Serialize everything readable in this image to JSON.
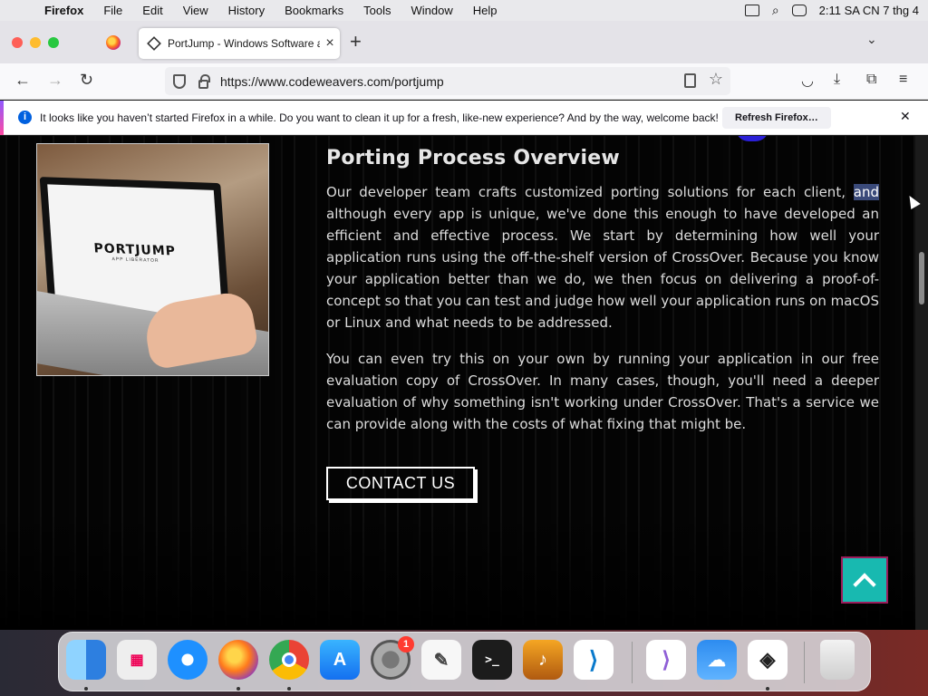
{
  "menubar": {
    "app": "Firefox",
    "items": [
      "File",
      "Edit",
      "View",
      "History",
      "Bookmarks",
      "Tools",
      "Window",
      "Help"
    ],
    "clock": "2:11 SA CN 7 thg 4"
  },
  "tabs": {
    "active_title": "PortJump - Windows Software a"
  },
  "navbar": {
    "url": "https://www.codeweavers.com/portjump"
  },
  "notification": {
    "message": "It looks like you haven’t started Firefox in a while. Do you want to clean it up for a fresh, like-new experience? And by the way, welcome back!",
    "button": "Refresh Firefox…"
  },
  "content": {
    "hero_logo": "PORTJUMP",
    "hero_tagline": "APP LIBERATOR",
    "title": "Porting Process Overview",
    "para1_before": "Our developer team crafts customized porting solutions for each client, ",
    "para1_selected": "and",
    "para1_after": " although every app is unique, we've done this enough to have developed an efficient and effective process. We start by determining how well your application runs using the off-the-shelf version of CrossOver. Because you know your application better than we do, we then focus on delivering a proof-of-concept so that you can test and judge how well your application runs on macOS or Linux and what needs to be addressed.",
    "para2": "You can even try this on your own by running your application in our free evaluation copy of CrossOver. In many cases, though, you'll need a deeper evaluation of why something isn't working under CrossOver. That's a service we can provide along with the costs of what fixing that might be.",
    "contact_button": "CONTACT US"
  },
  "dock": {
    "apps": [
      {
        "name": "finder-icon",
        "color": "#2d8cf0"
      },
      {
        "name": "launchpad-icon",
        "color": "#e8e8ea"
      },
      {
        "name": "safari-icon",
        "color": "#1e90ff"
      },
      {
        "name": "firefox-icon",
        "color": "#ff6f1f"
      },
      {
        "name": "chrome-icon",
        "color": "#ffffff"
      },
      {
        "name": "app-store-icon",
        "color": "#1a8cff"
      },
      {
        "name": "system-settings-icon",
        "color": "#8e8e93"
      },
      {
        "name": "textedit-icon",
        "color": "#f4f4f4"
      },
      {
        "name": "terminal-icon",
        "color": "#1c1c1c"
      },
      {
        "name": "garageband-icon",
        "color": "#f58a1f"
      },
      {
        "name": "vscode-icon",
        "color": "#ffffff"
      },
      {
        "name": "visual-studio-icon",
        "color": "#ffffff"
      },
      {
        "name": "weather-icon",
        "color": "#3a8fe6"
      },
      {
        "name": "crossover-icon",
        "color": "#ffffff"
      },
      {
        "name": "trash-icon",
        "color": "#e6e6e6"
      }
    ],
    "settings_badge": "1",
    "terminal_glyph": ">_"
  }
}
